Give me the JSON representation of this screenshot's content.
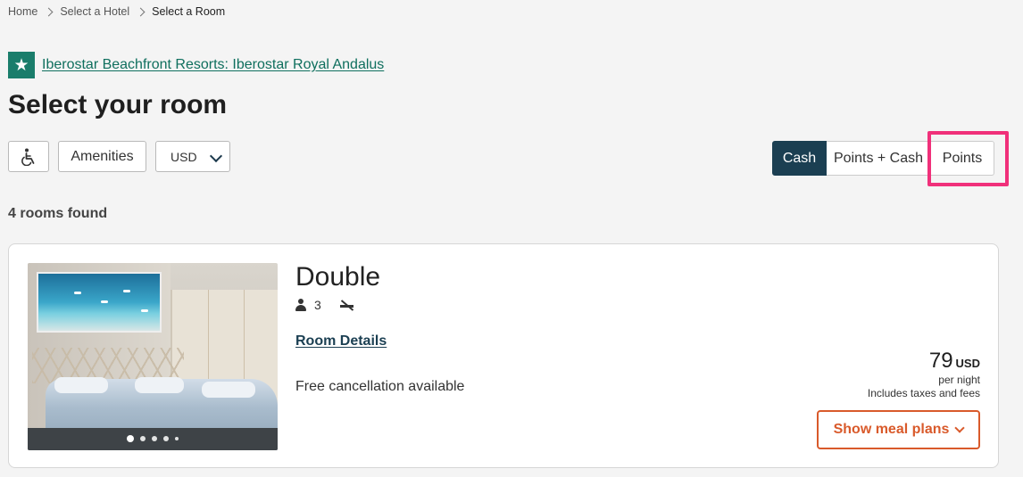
{
  "breadcrumb": {
    "items": [
      "Home",
      "Select a Hotel",
      "Select a Room"
    ]
  },
  "hotel": {
    "name": "Iberostar Beachfront Resorts: Iberostar Royal Andalus",
    "badge_icon": "star-icon",
    "brand_color": "#1a7d6b"
  },
  "page": {
    "title": "Select your room"
  },
  "filters": {
    "accessibility_icon": "wheelchair-icon",
    "amenities_label": "Amenities",
    "currency_value": "USD"
  },
  "payment_toggle": {
    "options": [
      "Cash",
      "Points + Cash",
      "Points"
    ],
    "selected": "Cash",
    "selected_color": "#1b3f52",
    "highlight_color": "#f0307a"
  },
  "results": {
    "count_text": "4 rooms found"
  },
  "room": {
    "name": "Double",
    "guests": "3",
    "details_link": "Room Details",
    "cancellation": "Free cancellation available",
    "price": "79",
    "price_currency": "USD",
    "per_night": "per night",
    "taxes_note": "Includes taxes and fees",
    "meal_button": "Show meal plans",
    "accent_color": "#d95a2b",
    "carousel_total": 5,
    "carousel_active": 1
  }
}
